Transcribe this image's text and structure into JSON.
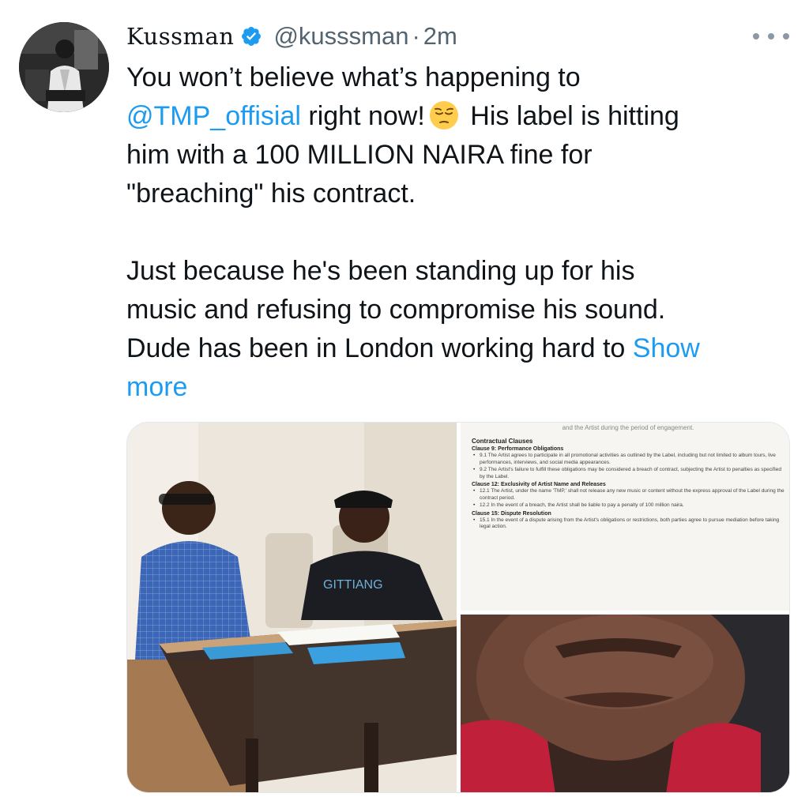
{
  "tweet": {
    "author_name": "Kussman",
    "handle": "@kusssman",
    "separator": "·",
    "time": "2m",
    "text": {
      "line1": "You won’t believe what’s happening to",
      "mention": "@TMP_offisial",
      "line2_after": " right now!",
      "line2_tail": " His label is hitting",
      "line3": "him with a 100 MILLION NAIRA fine for",
      "line4": "\"breaching\" his contract.",
      "line5": "Just because he's been standing up for his",
      "line6": "music and refusing to compromise his sound.",
      "line7": "Dude has been in London working hard to ",
      "show_more_a": "Show",
      "show_more_b": "more"
    },
    "emoji": "pensive-face"
  },
  "media": {
    "photo_left_alt": "",
    "document": {
      "top_line": "and the Artist during the period of engagement.",
      "heading": "Contractual Clauses",
      "clauses": [
        {
          "title": "Clause 9: Performance Obligations",
          "items": [
            "9.1 The Artist agrees to participate in all promotional activities as outlined by the Label, including but not limited to album tours, live performances, interviews, and social media appearances.",
            "9.2 The Artist's failure to fulfill these obligations may be considered a breach of contract, subjecting the Artist to penalties as specified by the Label."
          ]
        },
        {
          "title": "Clause 12: Exclusivity of Artist Name and Releases",
          "items": [
            "12.1 The Artist, under the name 'TMP,' shall not release any new music or content without the express approval of the Label during the contract period.",
            "12.2 In the event of a breach, the Artist shall be liable to pay a penalty of 100 million naira."
          ]
        },
        {
          "title": "Clause 15: Dispute Resolution",
          "items": [
            "15.1 In the event of a dispute arising from the Artist's obligations or restrictions, both parties agree to pursue mediation before taking legal action."
          ]
        }
      ]
    }
  },
  "colors": {
    "link": "#1d9bf0",
    "secondary_text": "#536471",
    "primary_text": "#0f1419",
    "verified_badge": "#1d9bf0"
  }
}
